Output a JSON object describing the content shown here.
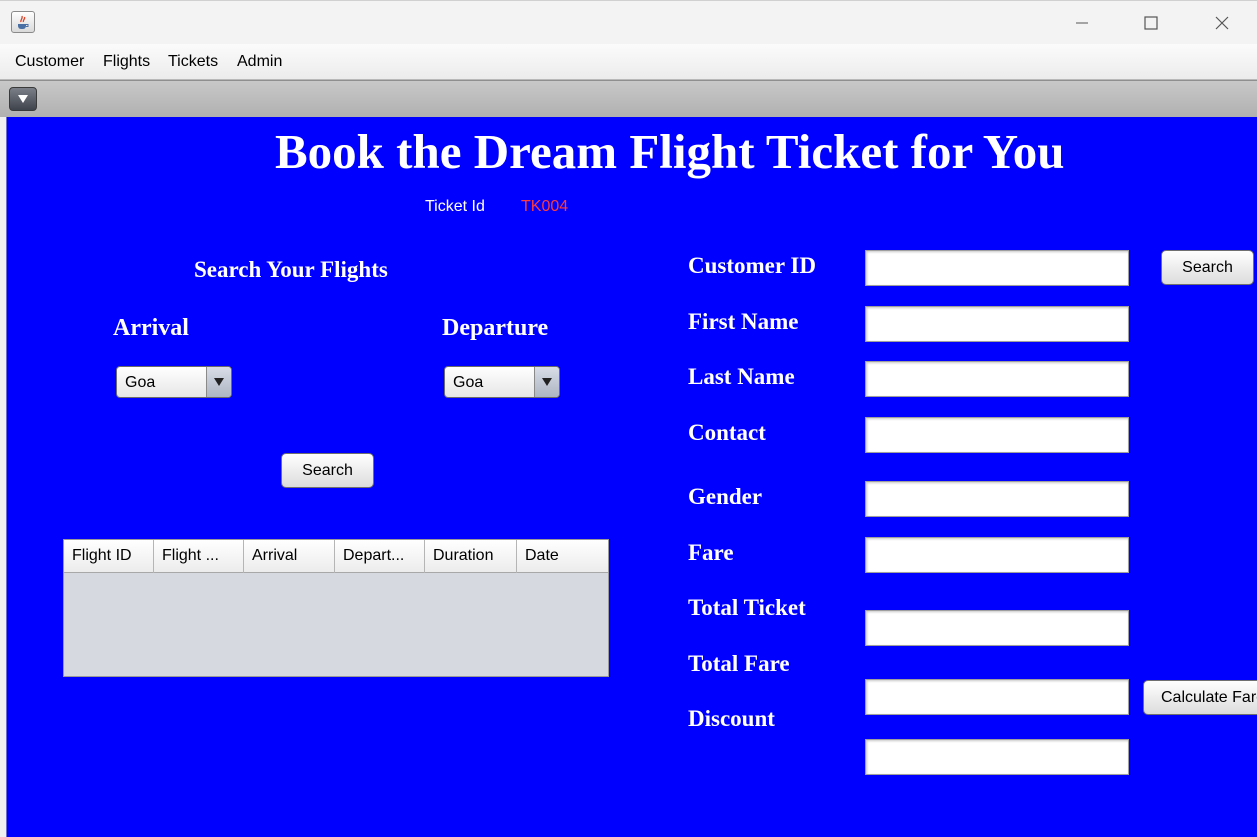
{
  "menu": {
    "items": [
      "Customer",
      "Flights",
      "Tickets",
      "Admin"
    ]
  },
  "header": {
    "title": "Book the Dream Flight Ticket for You",
    "ticket_label": "Ticket Id",
    "ticket_value": "TK004"
  },
  "search": {
    "heading": "Search Your Flights",
    "arrival_label": "Arrival",
    "departure_label": "Departure",
    "arrival_value": "Goa",
    "departure_value": "Goa",
    "button_label": "Search"
  },
  "table": {
    "columns": [
      "Flight ID",
      "Flight ...",
      "Arrival",
      "Depart...",
      "Duration",
      "Date"
    ],
    "rows": []
  },
  "customer_form": {
    "labels": {
      "customer_id": "Customer ID",
      "first_name": "First Name",
      "last_name": "Last Name",
      "contact": "Contact",
      "gender": "Gender",
      "fare": "Fare",
      "total_ticket": "Total Ticket",
      "total_fare": "Total Fare",
      "discount": "Discount"
    },
    "values": {
      "customer_id": "",
      "first_name": "",
      "last_name": "",
      "contact": "",
      "gender": "",
      "fare": "",
      "total_ticket": "",
      "total_fare": "",
      "discount": ""
    },
    "search_button": "Search",
    "calculate_button": "Calculate Fare"
  },
  "colors": {
    "panel_bg": "#0000ff",
    "ticket_value": "#ff3b3b"
  }
}
